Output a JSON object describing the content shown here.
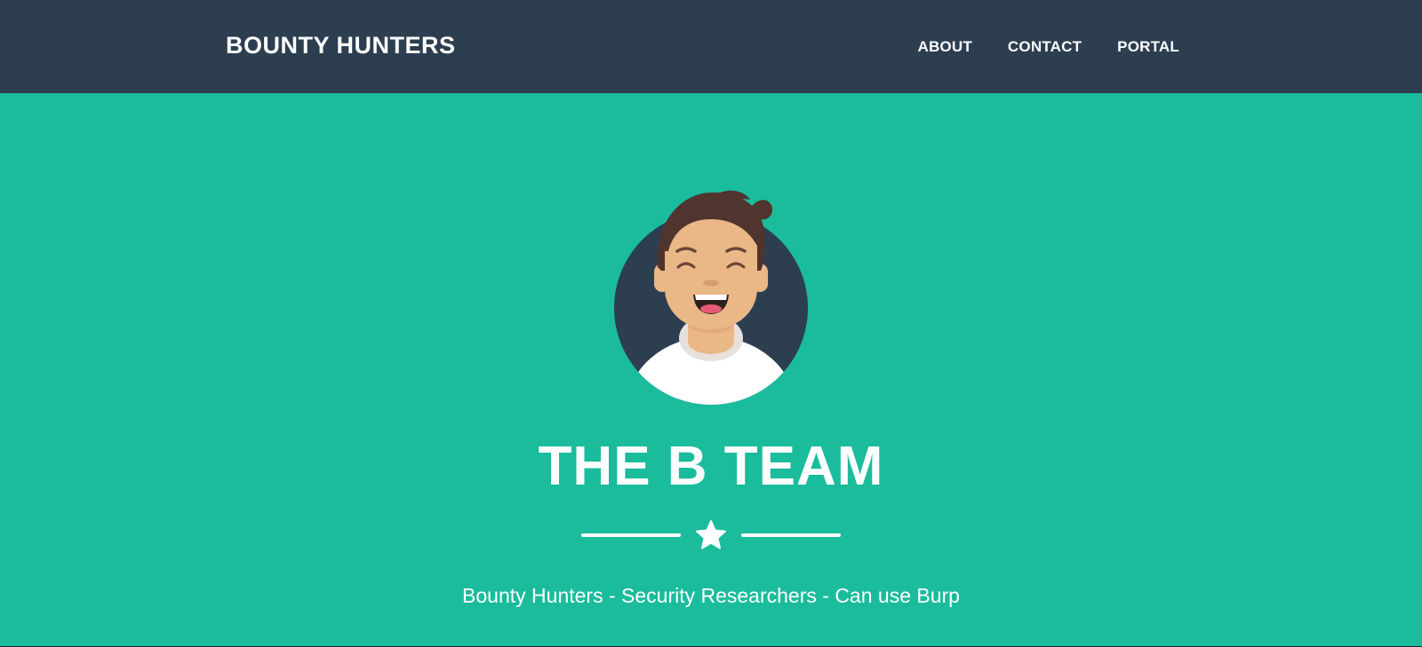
{
  "navbar": {
    "brand": "BOUNTY HUNTERS",
    "links": [
      {
        "label": "ABOUT"
      },
      {
        "label": "CONTACT"
      },
      {
        "label": "PORTAL"
      }
    ]
  },
  "masthead": {
    "avatar_icon": "smiling-avatar-icon",
    "title": "THE B TEAM",
    "divider_icon": "star-icon",
    "subtitle": "Bounty Hunters - Security Researchers - Can use Burp"
  },
  "colors": {
    "navbar_bg": "#2c3e50",
    "masthead_bg": "#1abc9c",
    "text": "#ffffff",
    "avatar_circle": "#2c3e50",
    "hair": "#50342e",
    "skin": "#eab787",
    "shirt": "#ffffff"
  }
}
